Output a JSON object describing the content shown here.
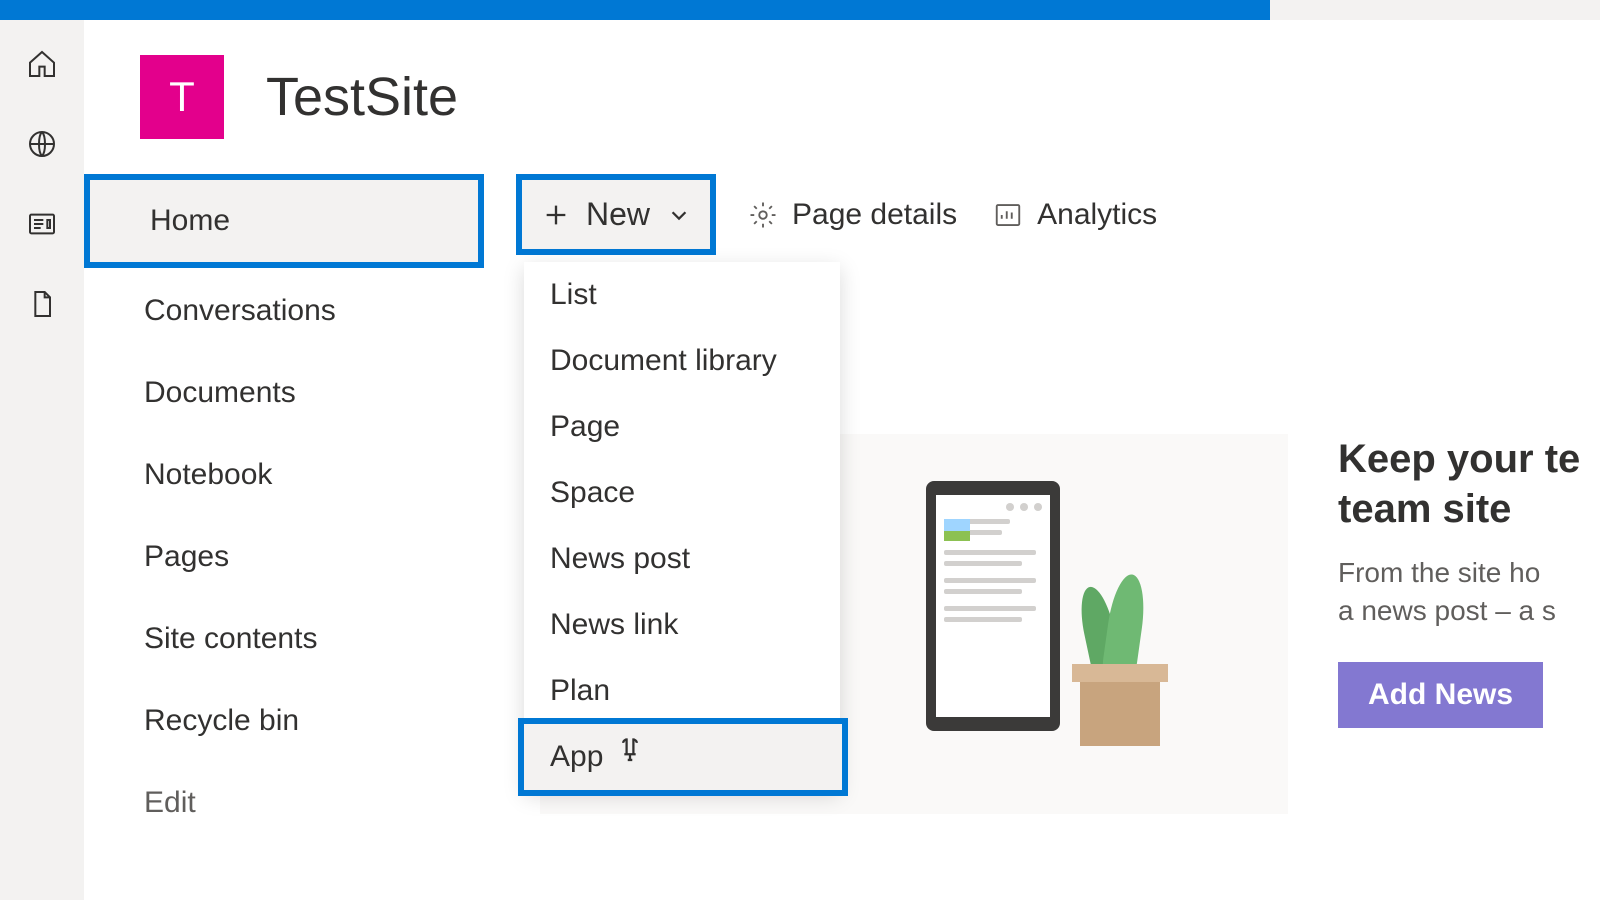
{
  "site": {
    "logo_letter": "T",
    "title": "TestSite"
  },
  "nav": {
    "items": [
      {
        "label": "Home"
      },
      {
        "label": "Conversations"
      },
      {
        "label": "Documents"
      },
      {
        "label": "Notebook"
      },
      {
        "label": "Pages"
      },
      {
        "label": "Site contents"
      },
      {
        "label": "Recycle bin"
      }
    ],
    "edit_label": "Edit"
  },
  "toolbar": {
    "new_label": "New",
    "page_details_label": "Page details",
    "analytics_label": "Analytics"
  },
  "new_dropdown": {
    "items": [
      {
        "label": "List"
      },
      {
        "label": "Document library"
      },
      {
        "label": "Page"
      },
      {
        "label": "Space"
      },
      {
        "label": "News post"
      },
      {
        "label": "News link"
      },
      {
        "label": "Plan"
      },
      {
        "label": "App"
      }
    ]
  },
  "news": {
    "title_line1": "Keep your te",
    "title_line2": "team site",
    "desc_line1": "From the site ho",
    "desc_line2": "a news post – a s",
    "button_label": "Add News"
  },
  "colors": {
    "brand": "#0078d4",
    "site_logo": "#e3008c",
    "add_news": "#8378d1"
  }
}
